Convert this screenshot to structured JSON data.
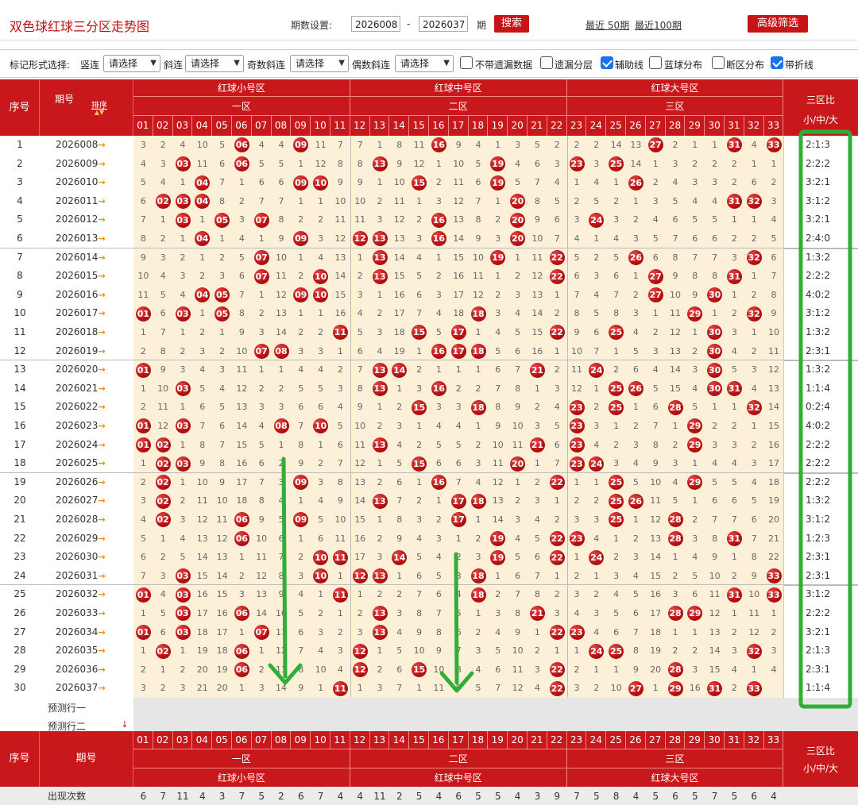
{
  "header": {
    "title": "双色球红球三分区走势图",
    "period_label": "期数设置:",
    "from": "2026008",
    "dash": "-",
    "to": "2026037",
    "period_unit": "期",
    "search": "搜索",
    "recent50": "最近 50期",
    "recent100": "最近100期",
    "advanced": "高级筛选"
  },
  "controls": {
    "mark_label": "标记形式选择:",
    "vert_label": "竖连",
    "slant_label": "斜连",
    "odd_label": "奇数斜连",
    "even_label": "偶数斜连",
    "select_placeholder": "请选择",
    "opts": [
      {
        "label": "不带遗漏数据",
        "checked": false
      },
      {
        "label": "遗漏分层",
        "checked": false
      },
      {
        "label": "辅助线",
        "checked": true
      },
      {
        "label": "蓝球分布",
        "checked": false
      },
      {
        "label": "断区分布",
        "checked": false
      },
      {
        "label": "带折线",
        "checked": true
      }
    ]
  },
  "table": {
    "seq_header": "序号",
    "period_header": "期号",
    "sort_label": "排序",
    "zones": [
      {
        "name": "红球小号区",
        "sub": "一区"
      },
      {
        "name": "红球中号区",
        "sub": "二区"
      },
      {
        "name": "红球大号区",
        "sub": "三区"
      }
    ],
    "ratio_header": "三区比",
    "ratio_sub": "小/中/大",
    "numbers": [
      "01",
      "02",
      "03",
      "04",
      "05",
      "06",
      "07",
      "08",
      "09",
      "10",
      "11",
      "12",
      "13",
      "14",
      "15",
      "16",
      "17",
      "18",
      "19",
      "20",
      "21",
      "22",
      "23",
      "24",
      "25",
      "26",
      "27",
      "28",
      "29",
      "30",
      "31",
      "32",
      "33"
    ],
    "rows": [
      {
        "seq": "1",
        "period": "2026008",
        "cells": [
          3,
          2,
          4,
          10,
          5,
          "06",
          4,
          4,
          "09",
          11,
          7,
          7,
          1,
          8,
          11,
          "16",
          9,
          4,
          1,
          3,
          5,
          2,
          2,
          2,
          14,
          13,
          "27",
          2,
          1,
          1,
          "31",
          4,
          "33"
        ],
        "ratio": "2:1:3"
      },
      {
        "seq": "2",
        "period": "2026009",
        "cells": [
          4,
          3,
          "03",
          11,
          6,
          "06",
          5,
          5,
          1,
          12,
          8,
          8,
          "13",
          9,
          12,
          1,
          10,
          5,
          "19",
          4,
          6,
          3,
          "23",
          3,
          "25",
          14,
          1,
          3,
          2,
          2,
          2,
          1,
          1
        ],
        "ratio": "2:2:2"
      },
      {
        "seq": "3",
        "period": "2026010",
        "cells": [
          5,
          4,
          1,
          "04",
          7,
          1,
          6,
          6,
          "09",
          "10",
          9,
          9,
          1,
          10,
          "15",
          2,
          11,
          6,
          "19",
          5,
          7,
          4,
          1,
          4,
          1,
          "26",
          2,
          4,
          3,
          3,
          2,
          6,
          2
        ],
        "ratio": "3:2:1"
      },
      {
        "seq": "4",
        "period": "2026011",
        "cells": [
          6,
          "02",
          "03",
          "04",
          8,
          2,
          7,
          7,
          1,
          1,
          10,
          10,
          2,
          11,
          1,
          3,
          12,
          7,
          1,
          "20",
          8,
          5,
          2,
          5,
          2,
          1,
          3,
          5,
          4,
          4,
          "31",
          "32",
          3
        ],
        "ratio": "3:1:2"
      },
      {
        "seq": "5",
        "period": "2026012",
        "cells": [
          7,
          1,
          "03",
          1,
          "05",
          3,
          "07",
          8,
          2,
          2,
          11,
          11,
          3,
          12,
          2,
          "16",
          13,
          8,
          2,
          "20",
          9,
          6,
          3,
          "24",
          3,
          2,
          4,
          6,
          5,
          5,
          1,
          1,
          4
        ],
        "ratio": "3:2:1"
      },
      {
        "seq": "6",
        "period": "2026013",
        "cells": [
          8,
          2,
          1,
          "04",
          1,
          4,
          1,
          9,
          "09",
          3,
          12,
          "12",
          "13",
          13,
          3,
          "16",
          14,
          9,
          3,
          "20",
          10,
          7,
          4,
          1,
          4,
          3,
          5,
          7,
          6,
          6,
          2,
          2,
          5
        ],
        "ratio": "2:4:0"
      },
      {
        "seq": "7",
        "period": "2026014",
        "cells": [
          9,
          3,
          2,
          1,
          2,
          5,
          "07",
          10,
          1,
          4,
          13,
          1,
          "13",
          14,
          4,
          1,
          15,
          10,
          "19",
          1,
          11,
          "22",
          5,
          2,
          5,
          "26",
          6,
          8,
          7,
          7,
          3,
          "32",
          6
        ],
        "ratio": "1:3:2"
      },
      {
        "seq": "8",
        "period": "2026015",
        "cells": [
          10,
          4,
          3,
          2,
          3,
          6,
          "07",
          11,
          2,
          "10",
          14,
          2,
          "13",
          15,
          5,
          2,
          16,
          11,
          1,
          2,
          12,
          "22",
          6,
          3,
          6,
          1,
          "27",
          9,
          8,
          8,
          "31",
          1,
          7
        ],
        "ratio": "2:2:2"
      },
      {
        "seq": "9",
        "period": "2026016",
        "cells": [
          11,
          5,
          4,
          "04",
          "05",
          7,
          1,
          12,
          "09",
          "10",
          15,
          3,
          1,
          16,
          6,
          3,
          17,
          12,
          2,
          3,
          13,
          1,
          7,
          4,
          7,
          2,
          "27",
          10,
          9,
          "30",
          1,
          2,
          8
        ],
        "ratio": "4:0:2"
      },
      {
        "seq": "10",
        "period": "2026017",
        "cells": [
          "01",
          6,
          "03",
          1,
          "05",
          8,
          2,
          13,
          1,
          1,
          16,
          4,
          2,
          17,
          7,
          4,
          18,
          "18",
          3,
          4,
          14,
          2,
          8,
          5,
          8,
          3,
          1,
          11,
          "29",
          1,
          2,
          "32",
          9
        ],
        "ratio": "3:1:2"
      },
      {
        "seq": "11",
        "period": "2026018",
        "cells": [
          1,
          7,
          1,
          2,
          1,
          9,
          3,
          14,
          2,
          2,
          "11",
          5,
          3,
          18,
          "15",
          5,
          "17",
          1,
          4,
          5,
          15,
          "22",
          9,
          6,
          "25",
          4,
          2,
          12,
          1,
          "30",
          3,
          1,
          10
        ],
        "ratio": "1:3:2"
      },
      {
        "seq": "12",
        "period": "2026019",
        "cells": [
          2,
          8,
          2,
          3,
          2,
          10,
          "07",
          "08",
          3,
          3,
          1,
          6,
          4,
          19,
          1,
          "16",
          "17",
          "18",
          5,
          6,
          16,
          1,
          10,
          7,
          1,
          5,
          3,
          13,
          2,
          "30",
          4,
          2,
          11
        ],
        "ratio": "2:3:1"
      },
      {
        "seq": "13",
        "period": "2026020",
        "cells": [
          "01",
          9,
          3,
          4,
          3,
          11,
          1,
          1,
          4,
          4,
          2,
          7,
          "13",
          "14",
          2,
          1,
          1,
          1,
          6,
          7,
          "21",
          2,
          11,
          "24",
          2,
          6,
          4,
          14,
          3,
          "30",
          5,
          3,
          12
        ],
        "ratio": "1:3:2"
      },
      {
        "seq": "14",
        "period": "2026021",
        "cells": [
          1,
          10,
          "03",
          5,
          4,
          12,
          2,
          2,
          5,
          5,
          3,
          8,
          "13",
          1,
          3,
          "16",
          2,
          2,
          7,
          8,
          1,
          3,
          12,
          1,
          "25",
          "26",
          5,
          15,
          4,
          "30",
          "31",
          4,
          13
        ],
        "ratio": "1:1:4"
      },
      {
        "seq": "15",
        "period": "2026022",
        "cells": [
          2,
          11,
          1,
          6,
          5,
          13,
          3,
          3,
          6,
          6,
          4,
          9,
          1,
          2,
          "15",
          3,
          3,
          "18",
          8,
          9,
          2,
          4,
          "23",
          2,
          "25",
          1,
          6,
          "28",
          5,
          1,
          1,
          "32",
          14
        ],
        "ratio": "0:2:4"
      },
      {
        "seq": "16",
        "period": "2026023",
        "cells": [
          "01",
          12,
          "03",
          7,
          6,
          14,
          4,
          "08",
          7,
          "10",
          5,
          10,
          2,
          3,
          1,
          4,
          4,
          1,
          9,
          10,
          3,
          5,
          "23",
          3,
          1,
          2,
          7,
          1,
          "29",
          2,
          2,
          1,
          15
        ],
        "ratio": "4:0:2"
      },
      {
        "seq": "17",
        "period": "2026024",
        "cells": [
          "01",
          "02",
          1,
          8,
          7,
          15,
          5,
          1,
          8,
          1,
          6,
          11,
          "13",
          4,
          2,
          5,
          5,
          2,
          10,
          11,
          "21",
          6,
          "23",
          4,
          2,
          3,
          8,
          2,
          "29",
          3,
          3,
          2,
          16
        ],
        "ratio": "2:2:2"
      },
      {
        "seq": "18",
        "period": "2026025",
        "cells": [
          1,
          "02",
          "03",
          9,
          8,
          16,
          6,
          2,
          9,
          2,
          7,
          12,
          1,
          5,
          "15",
          6,
          6,
          3,
          11,
          "20",
          1,
          7,
          "23",
          "24",
          3,
          4,
          9,
          3,
          1,
          4,
          4,
          3,
          17
        ],
        "ratio": "2:2:2"
      },
      {
        "seq": "19",
        "period": "2026026",
        "cells": [
          2,
          "02",
          1,
          10,
          9,
          17,
          7,
          3,
          "09",
          3,
          8,
          13,
          2,
          6,
          1,
          "16",
          7,
          4,
          12,
          1,
          2,
          "22",
          1,
          1,
          "25",
          5,
          10,
          4,
          "29",
          5,
          5,
          4,
          18
        ],
        "ratio": "2:2:2"
      },
      {
        "seq": "20",
        "period": "2026027",
        "cells": [
          3,
          "02",
          2,
          11,
          10,
          18,
          8,
          4,
          1,
          4,
          9,
          14,
          "13",
          7,
          2,
          1,
          "17",
          "18",
          13,
          2,
          3,
          1,
          2,
          2,
          "25",
          "26",
          11,
          5,
          1,
          6,
          6,
          5,
          19
        ],
        "ratio": "1:3:2"
      },
      {
        "seq": "21",
        "period": "2026028",
        "cells": [
          4,
          "02",
          3,
          12,
          11,
          "06",
          9,
          5,
          "09",
          5,
          10,
          15,
          1,
          8,
          3,
          2,
          "17",
          1,
          14,
          3,
          4,
          2,
          3,
          3,
          "25",
          1,
          12,
          "28",
          2,
          7,
          7,
          6,
          20
        ],
        "ratio": "3:1:2"
      },
      {
        "seq": "22",
        "period": "2026029",
        "cells": [
          5,
          1,
          4,
          13,
          12,
          "06",
          10,
          6,
          1,
          6,
          11,
          16,
          2,
          9,
          4,
          3,
          1,
          2,
          "19",
          4,
          5,
          "22",
          "23",
          4,
          1,
          2,
          13,
          "28",
          3,
          8,
          "31",
          7,
          21
        ],
        "ratio": "1:2:3"
      },
      {
        "seq": "23",
        "period": "2026030",
        "cells": [
          6,
          2,
          5,
          14,
          13,
          1,
          11,
          7,
          2,
          "10",
          "11",
          17,
          3,
          "14",
          5,
          4,
          2,
          3,
          "19",
          5,
          6,
          "22",
          1,
          "24",
          2,
          3,
          14,
          1,
          4,
          9,
          1,
          8,
          22
        ],
        "ratio": "2:3:1"
      },
      {
        "seq": "24",
        "period": "2026031",
        "cells": [
          7,
          3,
          "03",
          15,
          14,
          2,
          12,
          8,
          3,
          "10",
          1,
          "12",
          "13",
          1,
          6,
          5,
          3,
          "18",
          1,
          6,
          7,
          1,
          2,
          1,
          3,
          4,
          15,
          2,
          5,
          10,
          2,
          9,
          "33"
        ],
        "ratio": "2:3:1"
      },
      {
        "seq": "25",
        "period": "2026032",
        "cells": [
          "01",
          4,
          "03",
          16,
          15,
          3,
          13,
          9,
          4,
          1,
          "11",
          1,
          2,
          2,
          7,
          6,
          4,
          "18",
          2,
          7,
          8,
          2,
          3,
          2,
          4,
          5,
          16,
          3,
          6,
          11,
          "31",
          10,
          "33"
        ],
        "ratio": "3:1:2"
      },
      {
        "seq": "26",
        "period": "2026033",
        "cells": [
          1,
          5,
          "03",
          17,
          16,
          "06",
          14,
          10,
          5,
          2,
          1,
          2,
          "13",
          3,
          8,
          7,
          5,
          1,
          3,
          8,
          "21",
          3,
          4,
          3,
          5,
          6,
          17,
          "28",
          "29",
          12,
          1,
          11,
          1
        ],
        "ratio": "2:2:2"
      },
      {
        "seq": "27",
        "period": "2026034",
        "cells": [
          "01",
          6,
          "03",
          18,
          17,
          1,
          "07",
          11,
          6,
          3,
          2,
          3,
          "13",
          4,
          9,
          8,
          6,
          2,
          4,
          9,
          1,
          "22",
          "23",
          4,
          6,
          7,
          18,
          1,
          1,
          13,
          2,
          12,
          2
        ],
        "ratio": "3:2:1"
      },
      {
        "seq": "28",
        "period": "2026035",
        "cells": [
          1,
          "02",
          1,
          19,
          18,
          "06",
          1,
          12,
          7,
          4,
          3,
          "12",
          1,
          5,
          10,
          9,
          7,
          3,
          5,
          10,
          2,
          1,
          1,
          "24",
          "25",
          8,
          19,
          2,
          2,
          14,
          3,
          "32",
          3
        ],
        "ratio": "2:1:3"
      },
      {
        "seq": "29",
        "period": "2026036",
        "cells": [
          2,
          1,
          2,
          20,
          19,
          "06",
          2,
          13,
          8,
          10,
          4,
          "12",
          2,
          6,
          "15",
          10,
          8,
          4,
          6,
          11,
          3,
          "22",
          2,
          1,
          1,
          9,
          20,
          "28",
          3,
          15,
          4,
          1,
          4
        ],
        "ratio": "2:3:1"
      },
      {
        "seq": "30",
        "period": "2026037",
        "cells": [
          3,
          2,
          3,
          21,
          20,
          1,
          3,
          14,
          9,
          1,
          "11",
          1,
          3,
          7,
          1,
          11,
          9,
          5,
          7,
          12,
          4,
          "22",
          3,
          2,
          10,
          "27",
          1,
          "29",
          16,
          "31",
          2,
          "33"
        ],
        "ratio": "1:1:4"
      }
    ],
    "predict1": "预测行一",
    "predict2": "预测行二",
    "count_label": "出现次数",
    "counts": [
      6,
      7,
      11,
      4,
      3,
      7,
      5,
      2,
      6,
      7,
      4,
      4,
      11,
      2,
      5,
      4,
      6,
      5,
      5,
      4,
      3,
      9,
      7,
      5,
      8,
      4,
      5,
      6,
      5,
      7,
      5,
      6,
      4
    ]
  }
}
